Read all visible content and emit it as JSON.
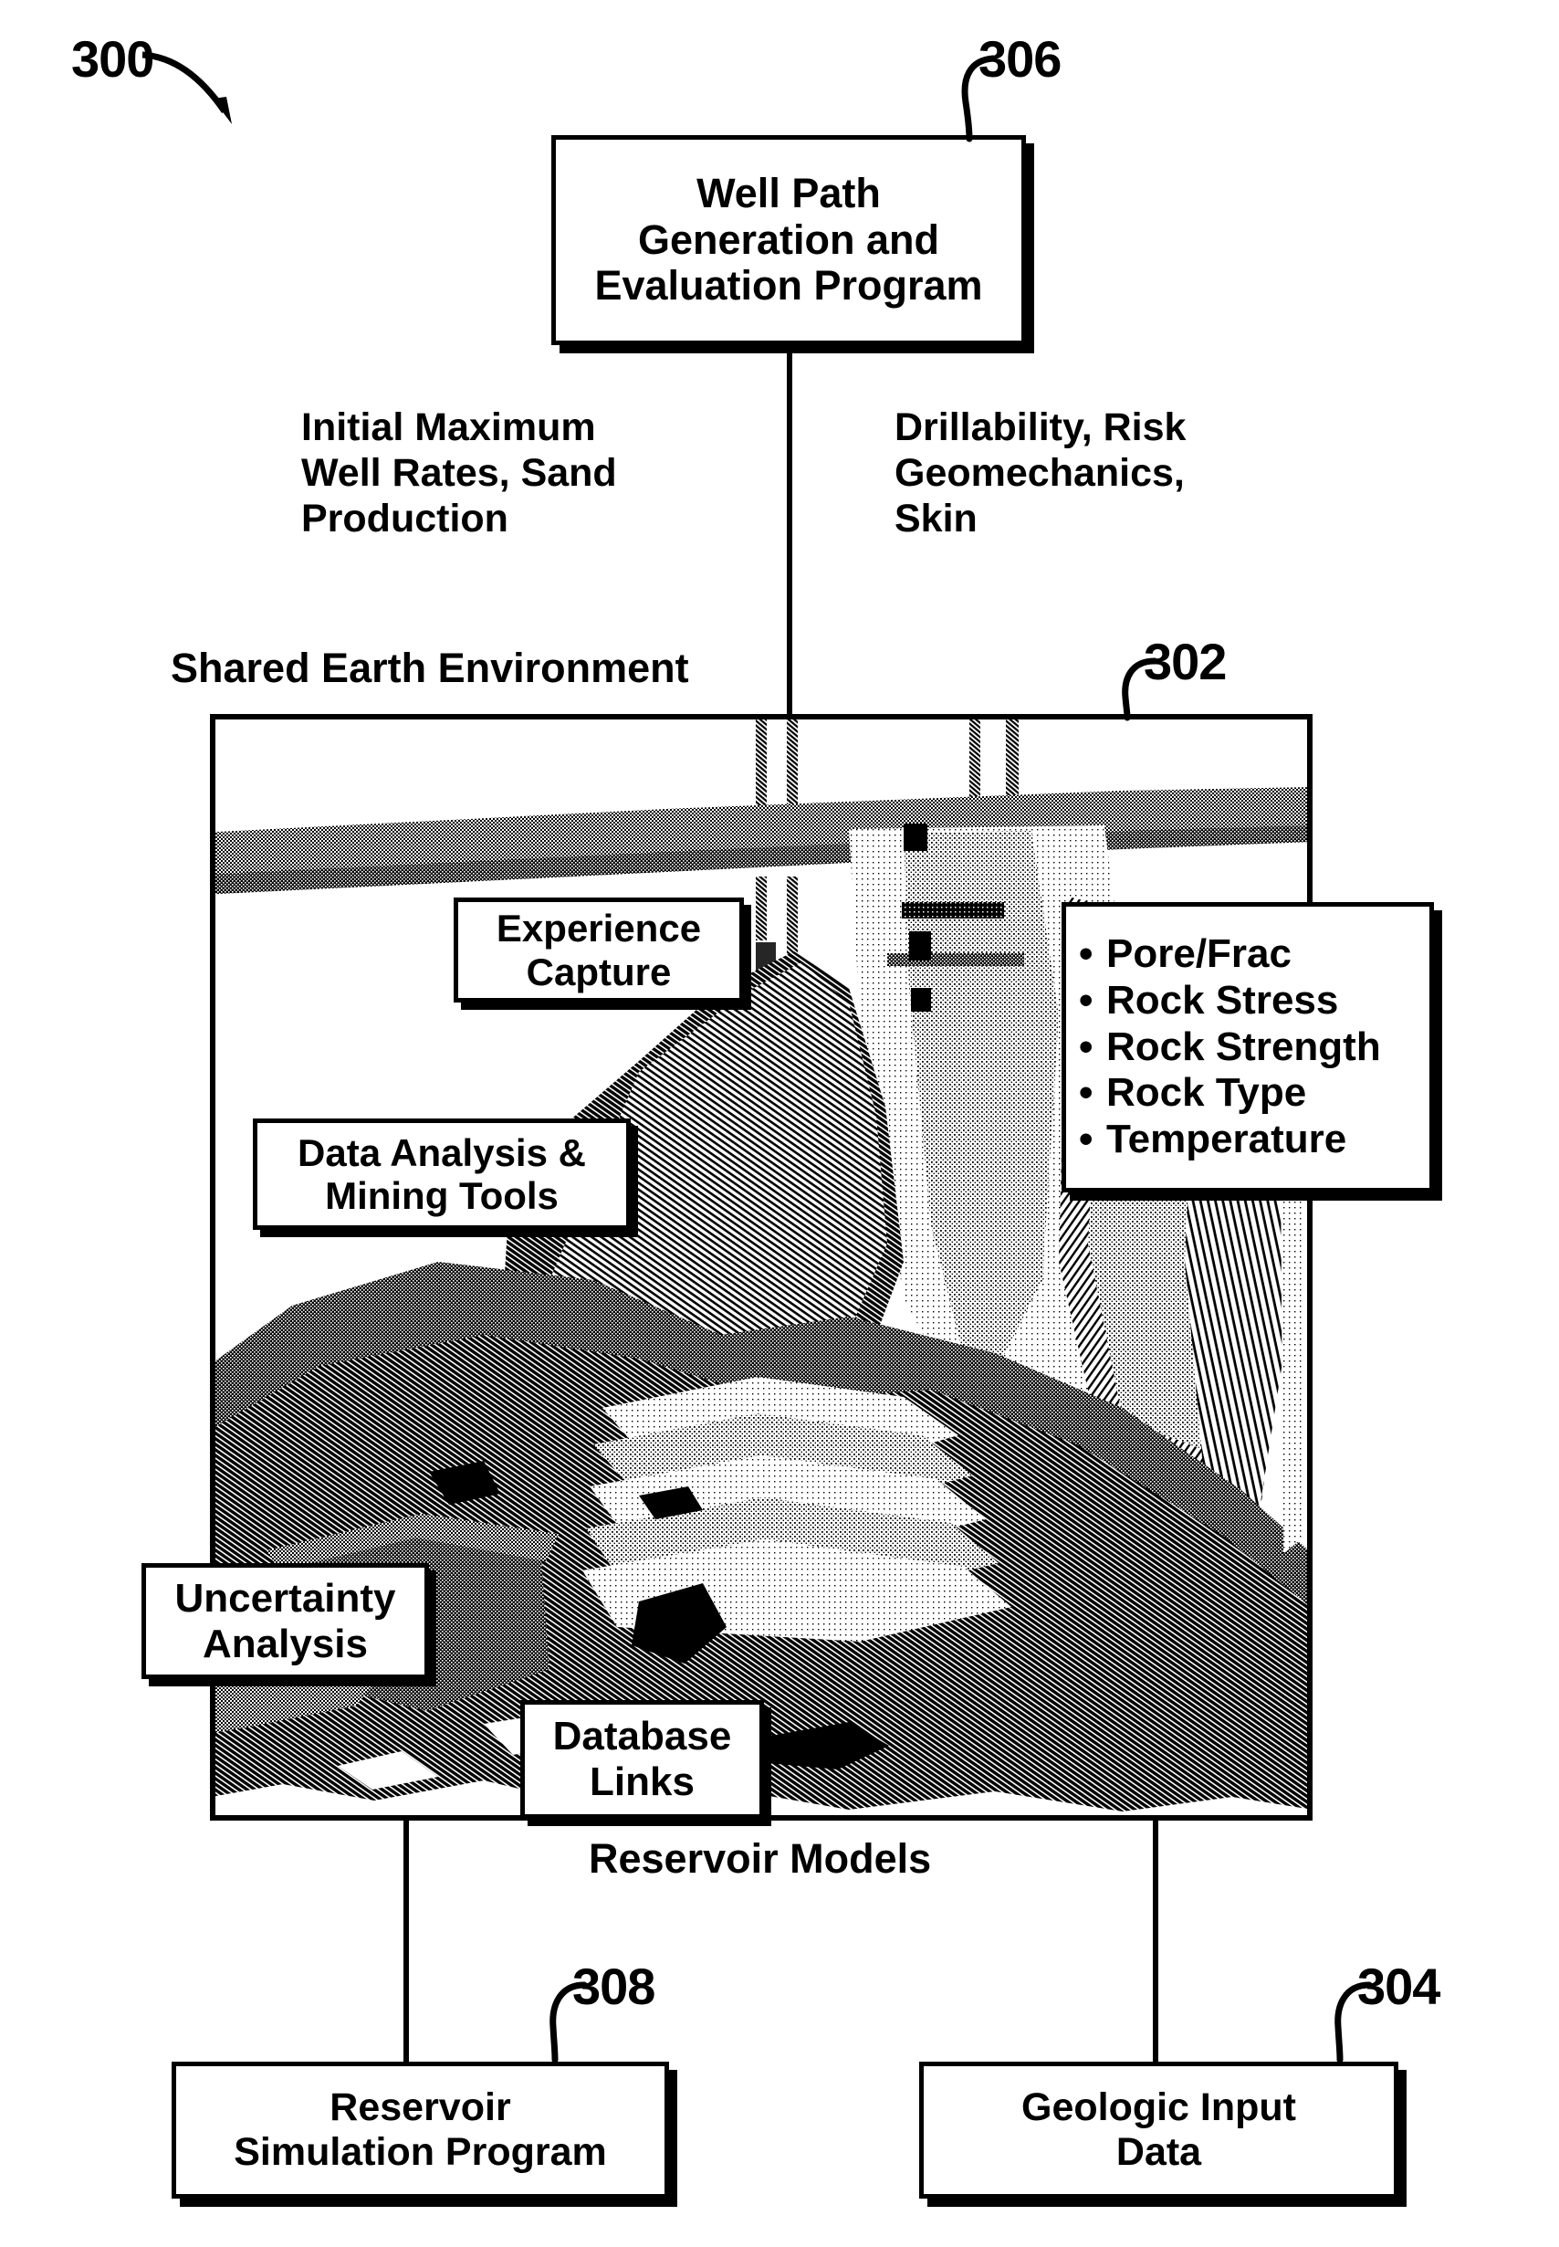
{
  "figure": {
    "number": "300",
    "type": "patent-block-diagram",
    "title_label": "Shared Earth Environment"
  },
  "refs": {
    "fig": "300",
    "well_path": "306",
    "shared_earth": "302",
    "reservoir_sim": "308",
    "geologic_input": "304"
  },
  "boxes": {
    "well_path": "Well Path\nGeneration and\nEvaluation Program",
    "reservoir_sim": "Reservoir\nSimulation Program",
    "geologic_input": "Geologic Input\nData"
  },
  "flows": {
    "left": "Initial Maximum\nWell Rates, Sand\nProduction",
    "right": "Drillability, Risk\nGeomechanics,\nSkin"
  },
  "frame": {
    "header_label": "Shared Earth Environment",
    "footer_label": "Reservoir Models",
    "callouts": [
      {
        "name": "experience-capture",
        "text": "Experience\nCapture"
      },
      {
        "name": "data-analysis-mining-tools",
        "text": "Data Analysis &\nMining Tools"
      },
      {
        "name": "uncertainty-analysis",
        "text": "Uncertainty\nAnalysis"
      },
      {
        "name": "database-links",
        "text": "Database\nLinks"
      }
    ],
    "properties_list": {
      "bullet": "•",
      "items": [
        "Pore/Frac",
        "Rock Stress",
        "Rock Strength",
        "Rock Type",
        "Temperature"
      ]
    },
    "content_description": "halftone 3D seismic / reservoir geological model with vertical well bores"
  },
  "colors": {
    "ink": "#000000",
    "paper": "#ffffff"
  }
}
